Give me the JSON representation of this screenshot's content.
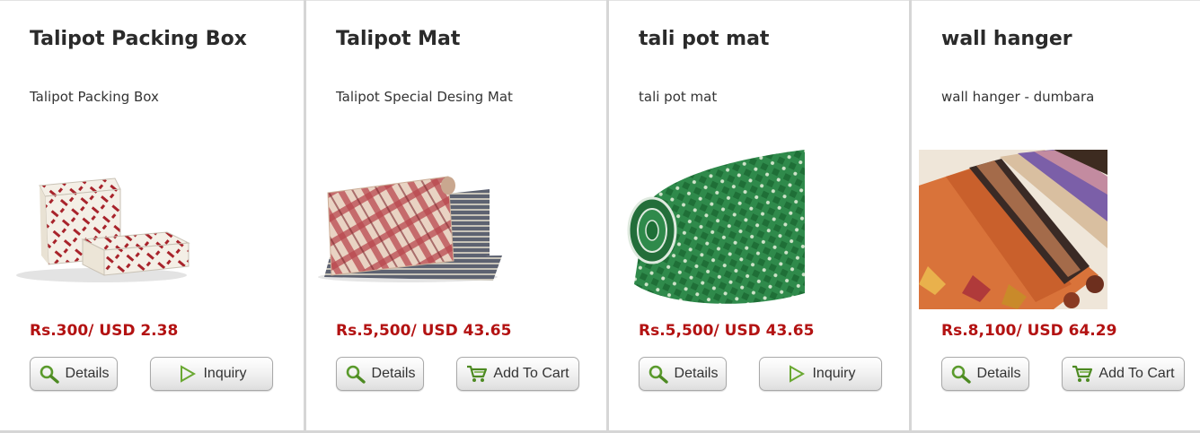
{
  "accent": {
    "price_color": "#b31212",
    "icon_green": "#5a9a2c"
  },
  "products": [
    {
      "title": "Talipot Packing Box",
      "description": "Talipot Packing Box",
      "price": "Rs.300/ USD 2.38",
      "details_label": "Details",
      "action_label": "Inquiry",
      "action_icon": "play-icon",
      "image": "packing-box-image"
    },
    {
      "title": "Talipot Mat",
      "description": "Talipot Special Desing Mat",
      "price": "Rs.5,500/ USD 43.65",
      "details_label": "Details",
      "action_label": "Add To Cart",
      "action_icon": "cart-icon",
      "image": "plaid-mat-image"
    },
    {
      "title": "tali pot mat",
      "description": "tali pot mat",
      "price": "Rs.5,500/ USD 43.65",
      "details_label": "Details",
      "action_label": "Inquiry",
      "action_icon": "play-icon",
      "image": "green-mat-image"
    },
    {
      "title": "wall hanger",
      "description": "wall hanger - dumbara",
      "price": "Rs.8,100/ USD 64.29",
      "details_label": "Details",
      "action_label": "Add To Cart",
      "action_icon": "cart-icon",
      "image": "wall-hanger-image"
    }
  ]
}
